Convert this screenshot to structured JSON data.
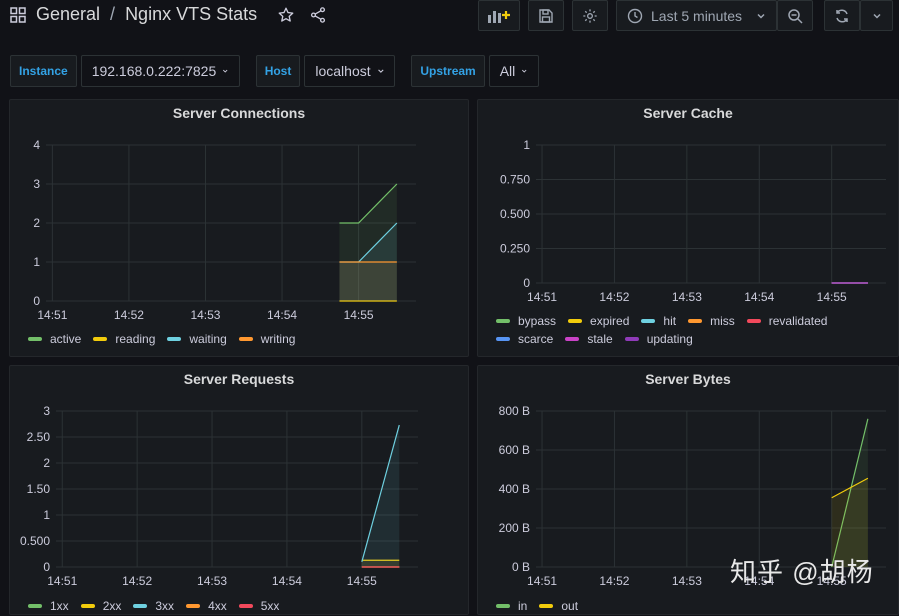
{
  "header": {
    "folder": "General",
    "separator": "/",
    "title": "Nginx VTS Stats",
    "time_range": "Last 5 minutes"
  },
  "variables": [
    {
      "label": "Instance",
      "value": "192.168.0.222:7825"
    },
    {
      "label": "Host",
      "value": "localhost"
    },
    {
      "label": "Upstream",
      "value": "All"
    }
  ],
  "colors": {
    "green": "#73bf69",
    "yellow": "#f2cc0c",
    "blue": "#8ab8ff",
    "orange": "#ff9830",
    "red": "#f2495c",
    "darkblue": "#5794f2",
    "purple": "#b877d9",
    "cyan": "#6ed0e0",
    "magenta": "#ca43c7"
  },
  "panels": {
    "connections": {
      "title": "Server Connections",
      "legend": [
        "active",
        "reading",
        "waiting",
        "writing"
      ]
    },
    "cache": {
      "title": "Server Cache",
      "legend": [
        "bypass",
        "expired",
        "hit",
        "miss",
        "revalidated",
        "scarce",
        "stale",
        "updating"
      ]
    },
    "requests": {
      "title": "Server Requests",
      "legend": [
        "1xx",
        "2xx",
        "3xx",
        "4xx",
        "5xx"
      ]
    },
    "bytes": {
      "title": "Server Bytes",
      "legend": [
        "in",
        "out"
      ]
    }
  },
  "chart_data": [
    {
      "type": "area",
      "title": "Server Connections",
      "x_ticks": [
        "14:51",
        "14:52",
        "14:53",
        "14:54",
        "14:55"
      ],
      "y_ticks": [
        "0",
        "1",
        "2",
        "3",
        "4"
      ],
      "ylim": [
        0,
        4
      ],
      "x": [
        "14:54:45",
        "14:55:00",
        "14:55:30"
      ],
      "series": [
        {
          "name": "active",
          "color": "#73bf69",
          "values": [
            2,
            2,
            3
          ]
        },
        {
          "name": "reading",
          "color": "#f2cc0c",
          "values": [
            0,
            0,
            0
          ]
        },
        {
          "name": "waiting",
          "color": "#6ed0e0",
          "values": [
            1,
            1,
            2
          ]
        },
        {
          "name": "writing",
          "color": "#ff9830",
          "values": [
            1,
            1,
            1
          ]
        }
      ]
    },
    {
      "type": "line",
      "title": "Server Cache",
      "x_ticks": [
        "14:51",
        "14:52",
        "14:53",
        "14:54",
        "14:55"
      ],
      "y_ticks": [
        "0",
        "0.250",
        "0.500",
        "0.750",
        "1"
      ],
      "ylim": [
        0,
        1
      ],
      "x": [
        "14:55:00",
        "14:55:30"
      ],
      "series": [
        {
          "name": "bypass",
          "color": "#73bf69",
          "values": [
            0,
            0
          ]
        },
        {
          "name": "expired",
          "color": "#f2cc0c",
          "values": [
            0,
            0
          ]
        },
        {
          "name": "hit",
          "color": "#6ed0e0",
          "values": [
            0,
            0
          ]
        },
        {
          "name": "miss",
          "color": "#ff9830",
          "values": [
            0,
            0
          ]
        },
        {
          "name": "revalidated",
          "color": "#f2495c",
          "values": [
            0,
            0
          ]
        },
        {
          "name": "scarce",
          "color": "#5794f2",
          "values": [
            0,
            0
          ]
        },
        {
          "name": "stale",
          "color": "#ca43c7",
          "values": [
            0,
            0
          ]
        },
        {
          "name": "updating",
          "color": "#8f3bb8",
          "values": [
            0,
            0
          ]
        }
      ]
    },
    {
      "type": "area",
      "title": "Server Requests",
      "x_ticks": [
        "14:51",
        "14:52",
        "14:53",
        "14:54",
        "14:55"
      ],
      "y_ticks": [
        "0",
        "0.500",
        "1",
        "1.50",
        "2",
        "2.50",
        "3"
      ],
      "ylim": [
        0,
        3
      ],
      "x": [
        "14:55:00",
        "14:55:30"
      ],
      "series": [
        {
          "name": "1xx",
          "color": "#73bf69",
          "values": [
            0,
            0
          ]
        },
        {
          "name": "2xx",
          "color": "#f2cc0c",
          "values": [
            0.13,
            0.13
          ]
        },
        {
          "name": "3xx",
          "color": "#6ed0e0",
          "values": [
            0.1,
            2.73
          ]
        },
        {
          "name": "4xx",
          "color": "#ff9830",
          "values": [
            0,
            0
          ]
        },
        {
          "name": "5xx",
          "color": "#f2495c",
          "values": [
            0,
            0
          ]
        }
      ]
    },
    {
      "type": "area",
      "title": "Server Bytes",
      "x_ticks": [
        "14:51",
        "14:52",
        "14:53",
        "14:54",
        "14:55"
      ],
      "y_ticks": [
        "0 B",
        "200 B",
        "400 B",
        "600 B",
        "800 B"
      ],
      "ylim": [
        0,
        800
      ],
      "x": [
        "14:55:00",
        "14:55:30"
      ],
      "series": [
        {
          "name": "in",
          "color": "#73bf69",
          "values": [
            0,
            760
          ]
        },
        {
          "name": "out",
          "color": "#f2cc0c",
          "values": [
            355,
            455
          ]
        }
      ]
    }
  ],
  "watermark": "知乎 @胡杨"
}
